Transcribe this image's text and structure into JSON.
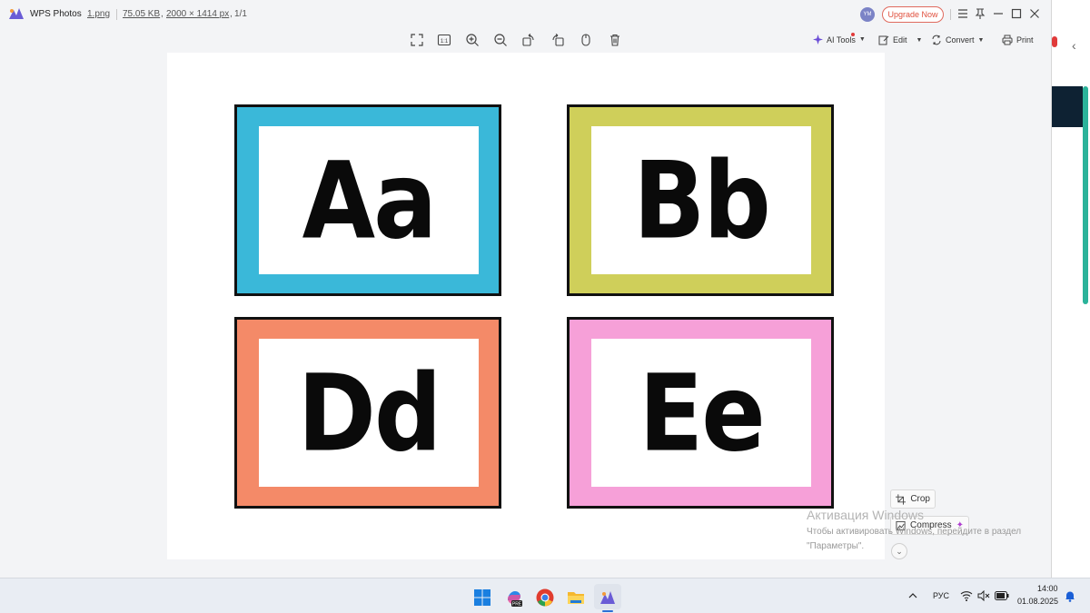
{
  "titlebar": {
    "app_name": "WPS Photos",
    "file_name": "1.png",
    "file_size": "75.05 KB",
    "file_dims": "2000 × 1414 px",
    "page": "1/1",
    "avatar_initials": "YM",
    "upgrade_label": "Upgrade Now"
  },
  "toolbar": {
    "ai_tools_label": "AI Tools",
    "edit_label": "Edit",
    "convert_label": "Convert",
    "print_label": "Print"
  },
  "image": {
    "cards": [
      {
        "letters": "Aa",
        "color": "#3ab8d9"
      },
      {
        "letters": "Bb",
        "color": "#cfcf5a"
      },
      {
        "letters": "Dd",
        "color": "#f48a68"
      },
      {
        "letters": "Ee",
        "color": "#f6a0d8"
      }
    ]
  },
  "side_panel": {
    "crop_label": "Crop",
    "compress_label": "Compress"
  },
  "watermark": {
    "line1": "Активация Windows",
    "line2": "Чтобы активировать Windows, перейдите в раздел",
    "line3": "\"Параметры\"."
  },
  "taskbar": {
    "language": "РУС",
    "time": "14:00",
    "date": "01.08.2025"
  },
  "colors": {
    "accent_upgrade": "#e0503e",
    "ai_dot": "#e03a3a"
  }
}
